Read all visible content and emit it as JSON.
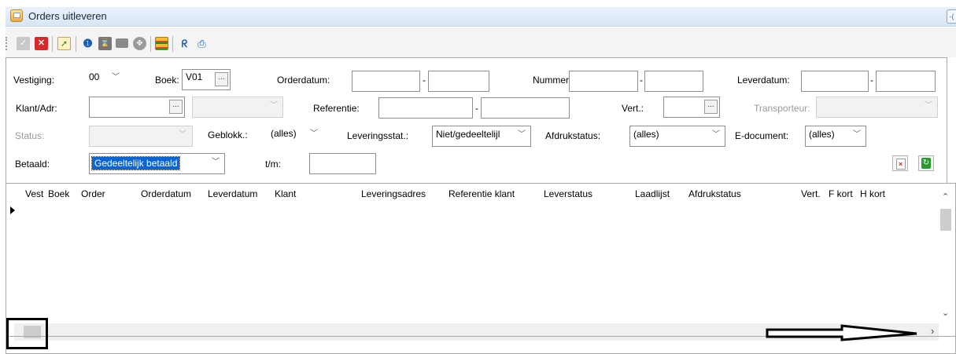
{
  "window": {
    "title": "Orders uitleveren",
    "side_button": "-("
  },
  "toolbar": {
    "icons": [
      "check-icon",
      "cancel-x-icon",
      "export-arrow-icon",
      "info-icon",
      "hourglass-icon",
      "gray-block-icon",
      "globe-icon",
      "grid-edit-icon",
      "pin-icon",
      "save-icon"
    ]
  },
  "filters": {
    "vestiging": {
      "label": "Vestiging:",
      "value": "00"
    },
    "boek": {
      "label": "Boek:",
      "value": "V01",
      "dots": "..."
    },
    "orderdatum": {
      "label": "Orderdatum:",
      "from": "",
      "to": "",
      "dash": "-"
    },
    "nummer": {
      "label": "Nummer:",
      "from": "",
      "to": "",
      "dash": "-"
    },
    "leverdatum": {
      "label": "Leverdatum:",
      "from": "",
      "to": "",
      "dash": "-"
    },
    "klant": {
      "label": "Klant/Adr:",
      "value": "",
      "dots": "..."
    },
    "adres": {
      "value": ""
    },
    "referentie": {
      "label": "Referentie:",
      "from": "",
      "to": "",
      "dash": "-"
    },
    "vert": {
      "label": "Vert.:",
      "value": "",
      "dots": "..."
    },
    "transporteur": {
      "label": "Transporteur:",
      "value": ""
    },
    "status": {
      "label": "Status:",
      "value": ""
    },
    "geblokk": {
      "label": "Geblokk.:",
      "value": "(alles)"
    },
    "leveringsstat": {
      "label": "Leveringsstat.:",
      "value": "Niet/gedeeltelijl"
    },
    "afdrukstatus": {
      "label": "Afdrukstatus:",
      "value": "(alles)"
    },
    "edocument": {
      "label": "E-document:",
      "value": "(alles)"
    },
    "betaald": {
      "label": "Betaald:",
      "value": "Gedeeltelijk betaald"
    },
    "tm": {
      "label": "t/m:",
      "value": ""
    }
  },
  "grid": {
    "columns": [
      "Vest",
      "Boek",
      "Order",
      "Orderdatum",
      "Leverdatum",
      "Klant",
      "Leveringsadres",
      "Referentie klant",
      "Leverstatus",
      "Laadlijst",
      "Afdrukstatus",
      "Vert.",
      "F kort",
      "H kort"
    ],
    "rows": []
  },
  "colors": {
    "titlebar": "#dde9f6",
    "selection": "#0a64d2",
    "annotation": "#000000"
  }
}
